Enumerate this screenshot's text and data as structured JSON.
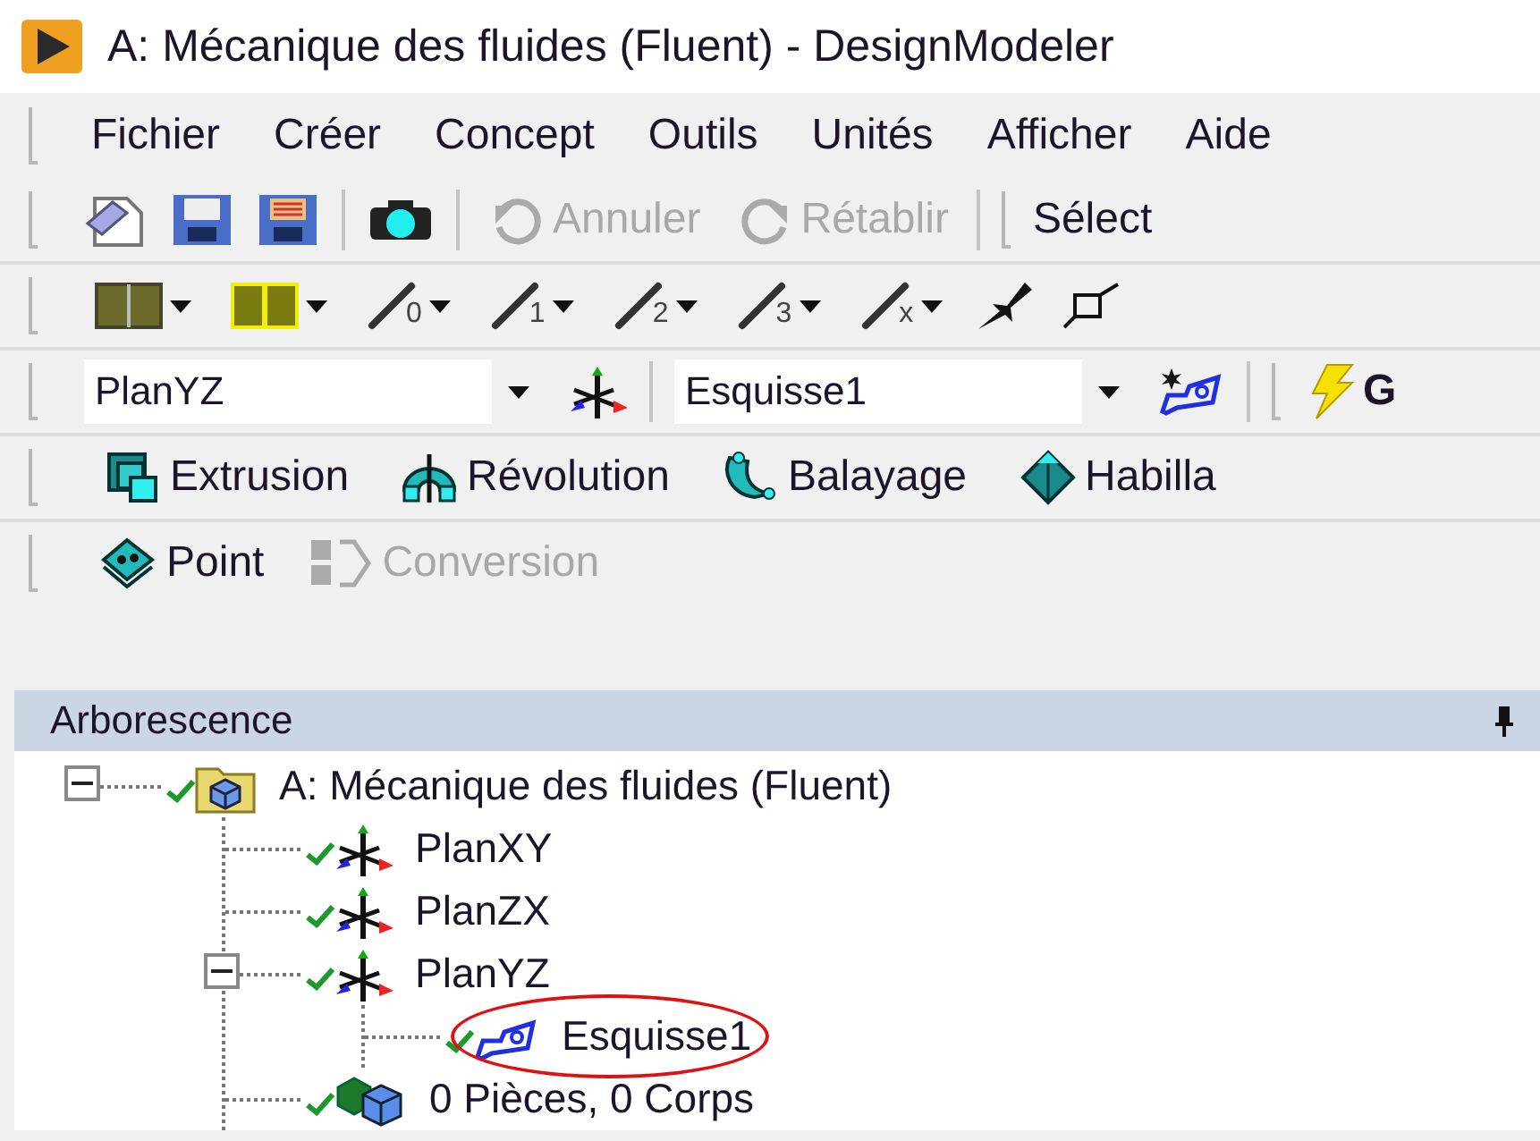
{
  "window": {
    "title": "A: Mécanique des fluides (Fluent) - DesignModeler"
  },
  "menu": [
    "Fichier",
    "Créer",
    "Concept",
    "Outils",
    "Unités",
    "Afficher",
    "Aide"
  ],
  "edit_toolbar": {
    "undo": {
      "label": "Annuler",
      "disabled": true
    },
    "redo": {
      "label": "Rétablir",
      "disabled": true
    },
    "select": "Sélect"
  },
  "line_tools": [
    "0",
    "1",
    "2",
    "3",
    "x"
  ],
  "sketch_toolbar": {
    "plane": {
      "value": "PlanYZ"
    },
    "sketch": {
      "value": "Esquisse1"
    },
    "generate": "G"
  },
  "features": [
    {
      "label": "Extrusion"
    },
    {
      "label": "Révolution"
    },
    {
      "label": "Balayage"
    },
    {
      "label": "Habilla"
    }
  ],
  "tools": [
    {
      "label": "Point",
      "disabled": false
    },
    {
      "label": "Conversion",
      "disabled": true
    }
  ],
  "tree": {
    "title": "Arborescence",
    "items": [
      {
        "label": "A: Mécanique des fluides (Fluent)",
        "kind": "model",
        "expanded": true,
        "circled": false,
        "children": [
          {
            "label": "PlanXY",
            "kind": "plane",
            "circled": false
          },
          {
            "label": "PlanZX",
            "kind": "plane",
            "circled": false
          },
          {
            "label": "PlanYZ",
            "kind": "plane",
            "expanded": true,
            "circled": false,
            "children": [
              {
                "label": "Esquisse1",
                "kind": "sketch",
                "circled": true
              }
            ]
          },
          {
            "label": "0 Pièces, 0 Corps",
            "kind": "bodies",
            "circled": false
          }
        ]
      }
    ]
  }
}
